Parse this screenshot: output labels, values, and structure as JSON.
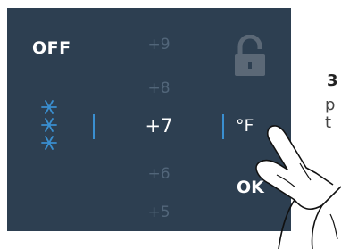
{
  "panel": {
    "off_label": "OFF",
    "temperatures": [
      "+9",
      "+8",
      "+7",
      "+6",
      "+5"
    ],
    "selected_temperature": "+7",
    "unit_label": "°F",
    "ok_label": "OK",
    "icons": {
      "mode": "snowflake-icon",
      "lock": "unlocked-padlock-icon"
    },
    "colors": {
      "background": "#2d3f51",
      "accent": "#3a8fd0",
      "dim_text": "#52667a"
    }
  },
  "side_text": {
    "number": "3",
    "line1": "p",
    "line2": "t"
  }
}
